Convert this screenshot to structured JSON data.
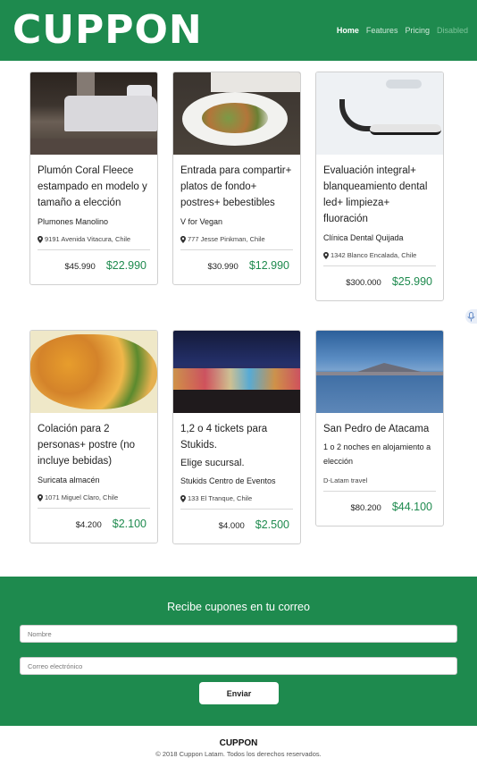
{
  "header": {
    "logo": "CUPPON",
    "nav": [
      {
        "label": "Home",
        "state": "active"
      },
      {
        "label": "Features",
        "state": "normal"
      },
      {
        "label": "Pricing",
        "state": "normal"
      },
      {
        "label": "Disabled",
        "state": "disabled"
      }
    ]
  },
  "deals": [
    {
      "title": "Plumón Coral Fleece estampado en modelo y tamaño a elección",
      "merchant": "Plumones Manolino",
      "address": "9191 Avenida Vitacura, Chile",
      "old_price": "$45.990",
      "new_price": "$22.990",
      "image": "bedroom-photo"
    },
    {
      "title": "Entrada para compartir+ platos de fondo+ postres+ bebestibles",
      "merchant": "V for Vegan",
      "address": "777 Jesse Pinkman, Chile",
      "old_price": "$30.990",
      "new_price": "$12.990",
      "image": "salad-plate-photo"
    },
    {
      "title": "Evaluación integral+ blanqueamiento dental led+ limpieza+ fluoración",
      "merchant": "Clínica Dental Quijada",
      "address": "1342 Blanco Encalada, Chile",
      "old_price": "$300.000",
      "new_price": "$25.990",
      "image": "dental-chair-photo"
    },
    {
      "title": "Colación para 2 personas+ postre (no incluye bebidas)",
      "merchant": "Suricata almacén",
      "address": "1071 Miguel Claro, Chile",
      "old_price": "$4.200",
      "new_price": "$2.100",
      "image": "curry-dish-photo"
    },
    {
      "title": "1,2 o 4 tickets para Stukids.",
      "subtitle": "Elige sucursal.",
      "merchant": "Stukids Centro de Eventos",
      "address": "133 El Tranque, Chile",
      "old_price": "$4.000",
      "new_price": "$2.500",
      "image": "fair-night-photo"
    },
    {
      "title": "San Pedro de Atacama",
      "merchant": "1 o 2 noches en alojamiento a elección",
      "address": "D-Latam travel",
      "old_price": "$80.200",
      "new_price": "$44.100",
      "image": "salt-lake-photo"
    }
  ],
  "newsletter": {
    "title": "Recibe cupones en tu correo",
    "name_placeholder": "Nombre",
    "email_placeholder": "Correo electrónico",
    "submit_label": "Enviar"
  },
  "footer": {
    "brand": "CUPPON",
    "copyright": "© 2018 Cuppon Latam. Todos los derechos reservados."
  },
  "colors": {
    "brand_green": "#1e8a4e",
    "price_green": "#1e8a4e"
  }
}
